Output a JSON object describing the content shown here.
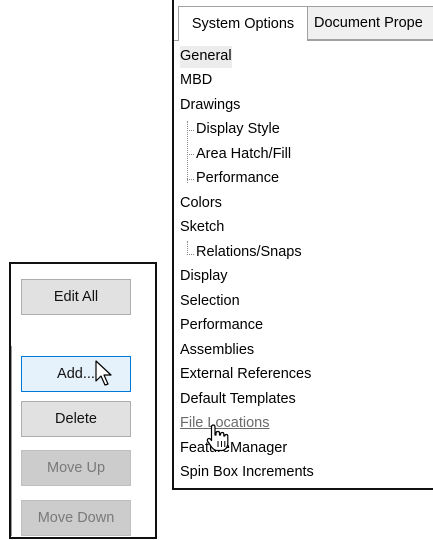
{
  "buttons": {
    "edit_all": "Edit All",
    "add": "Add...",
    "delete": "Delete",
    "move_up": "Move Up",
    "move_down": "Move Down"
  },
  "tabs": {
    "system_options": "System Options",
    "document_properties": "Document Prope"
  },
  "tree": [
    {
      "label": "General",
      "level": 0,
      "selected": true
    },
    {
      "label": "MBD",
      "level": 0
    },
    {
      "label": "Drawings",
      "level": 0
    },
    {
      "label": "Display Style",
      "level": 1
    },
    {
      "label": "Area Hatch/Fill",
      "level": 1
    },
    {
      "label": "Performance",
      "level": 1
    },
    {
      "label": "Colors",
      "level": 0
    },
    {
      "label": "Sketch",
      "level": 0
    },
    {
      "label": "Relations/Snaps",
      "level": 1
    },
    {
      "label": "Display",
      "level": 0
    },
    {
      "label": "Selection",
      "level": 0
    },
    {
      "label": "Performance",
      "level": 0
    },
    {
      "label": "Assemblies",
      "level": 0
    },
    {
      "label": "External References",
      "level": 0
    },
    {
      "label": "Default Templates",
      "level": 0
    },
    {
      "label": "File Locations",
      "level": 0,
      "hovered": true
    },
    {
      "label": "FeatureManager",
      "level": 0
    },
    {
      "label": "Spin Box Increments",
      "level": 0
    }
  ]
}
